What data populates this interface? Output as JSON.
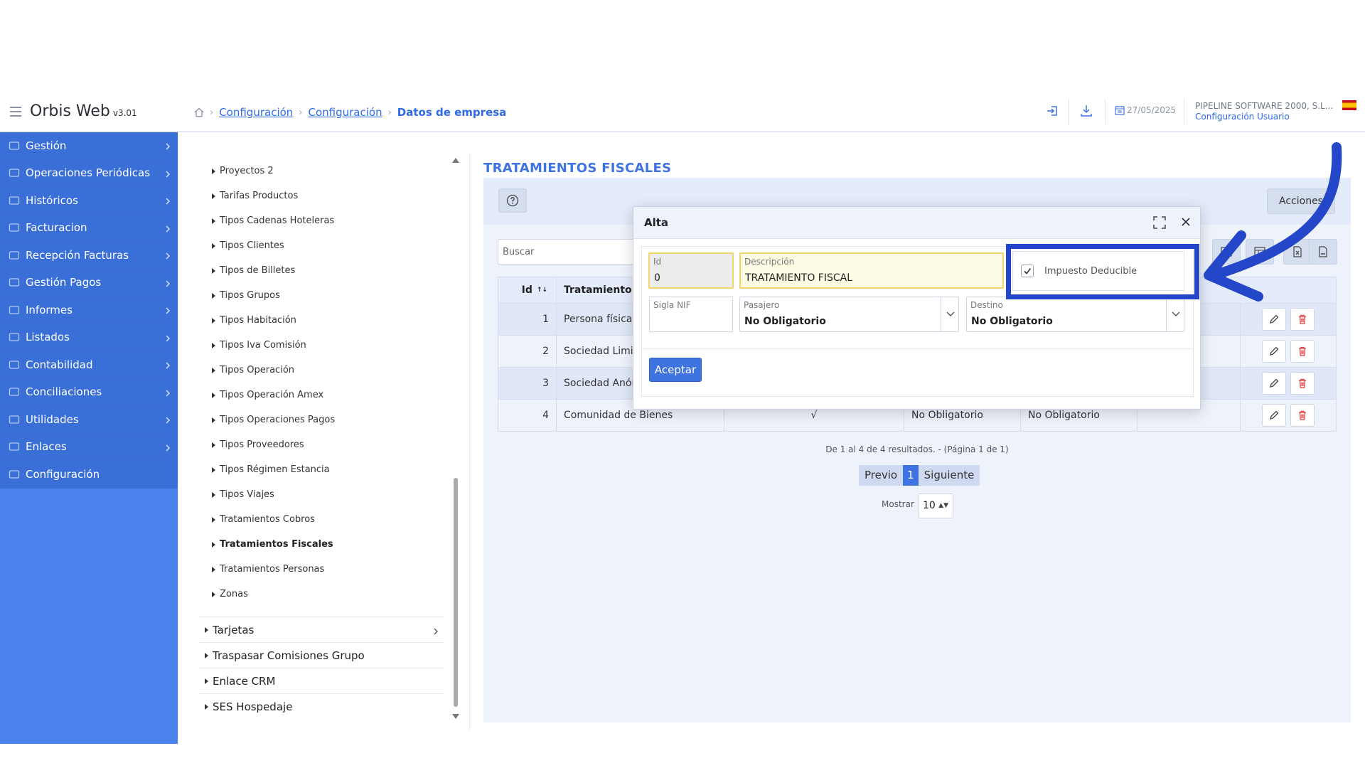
{
  "header": {
    "app_name": "Orbis Web",
    "app_version": "v3.01",
    "breadcrumb": [
      "Configuración",
      "Configuración",
      "Datos de empresa"
    ],
    "date": "27/05/2025",
    "company": "PIPELINE SOFTWARE 2000, S.L...",
    "config_user": "Configuración Usuario"
  },
  "sidebar": {
    "items": [
      {
        "label": "Gestión",
        "icon": "briefcase-icon"
      },
      {
        "label": "Operaciones Periódicas",
        "icon": "network-icon"
      },
      {
        "label": "Históricos",
        "icon": "folder-icon"
      },
      {
        "label": "Facturacion",
        "icon": "bank-icon"
      },
      {
        "label": "Recepción Facturas",
        "icon": "card-icon"
      },
      {
        "label": "Gestión Pagos",
        "icon": "wallet-icon"
      },
      {
        "label": "Informes",
        "icon": "report-icon"
      },
      {
        "label": "Listados",
        "icon": "document-icon"
      },
      {
        "label": "Contabilidad",
        "icon": "ledger-icon"
      },
      {
        "label": "Conciliaciones",
        "icon": "link-icon"
      },
      {
        "label": "Utilidades",
        "icon": "tools-icon"
      },
      {
        "label": "Enlaces",
        "icon": "chain-icon"
      },
      {
        "label": "Configuración",
        "icon": "gear-icon"
      }
    ]
  },
  "tree": {
    "items": [
      "Proyectos 2",
      "Tarifas Productos",
      "Tipos Cadenas Hoteleras",
      "Tipos Clientes",
      "Tipos de Billetes",
      "Tipos Grupos",
      "Tipos Habitación",
      "Tipos Iva Comisión",
      "Tipos Operación",
      "Tipos Operación Amex",
      "Tipos Operaciones Pagos",
      "Tipos Proveedores",
      "Tipos Régimen Estancia",
      "Tipos Viajes",
      "Tratamientos Cobros",
      "Tratamientos Fiscales",
      "Tratamientos Personas",
      "Zonas"
    ],
    "selected": "Tratamientos Fiscales",
    "groups": [
      "Tarjetas",
      "Traspasar Comisiones Grupo",
      "Enlace CRM",
      "SES Hospedaje"
    ]
  },
  "main": {
    "title": "TRATAMIENTOS FISCALES",
    "acciones_label": "Acciones",
    "search_placeholder": "Buscar",
    "table": {
      "headers": [
        "Id",
        "Tratamiento Fi"
      ],
      "rows": [
        {
          "id": "1",
          "tratamiento": "Persona física",
          "impuesto": "",
          "pasajero": "",
          "destino": ""
        },
        {
          "id": "2",
          "tratamiento": "Sociedad Limita",
          "impuesto": "",
          "pasajero": "",
          "destino": ""
        },
        {
          "id": "3",
          "tratamiento": "Sociedad Anón",
          "impuesto": "",
          "pasajero": "",
          "destino": ""
        },
        {
          "id": "4",
          "tratamiento": "Comunidad de Bienes",
          "impuesto": "√",
          "pasajero": "No Obligatorio",
          "destino": "No Obligatorio"
        }
      ]
    },
    "results_text": "De 1 al 4 de 4 resultados. - (Página 1 de 1)",
    "pager": {
      "prev": "Previo",
      "current": "1",
      "next": "Siguiente"
    },
    "mostrar_label": "Mostrar",
    "mostrar_value": "10"
  },
  "modal": {
    "title": "Alta",
    "id_label": "Id",
    "id_value": "0",
    "descripcion_label": "Descripción",
    "descripcion_value": "TRATAMIENTO FISCAL",
    "checkbox_label": "Impuesto Deducible",
    "checkbox_checked": true,
    "sigla_label": "Sigla NIF",
    "sigla_value": "",
    "pasajero_label": "Pasajero",
    "pasajero_value": "No Obligatorio",
    "destino_label": "Destino",
    "destino_value": "No Obligatorio",
    "aceptar_label": "Aceptar"
  },
  "colors": {
    "sidebar": "#4a82ec",
    "accent": "#3f74e0",
    "highlight": "#2446c9",
    "field_highlight": "#f0d56a"
  }
}
